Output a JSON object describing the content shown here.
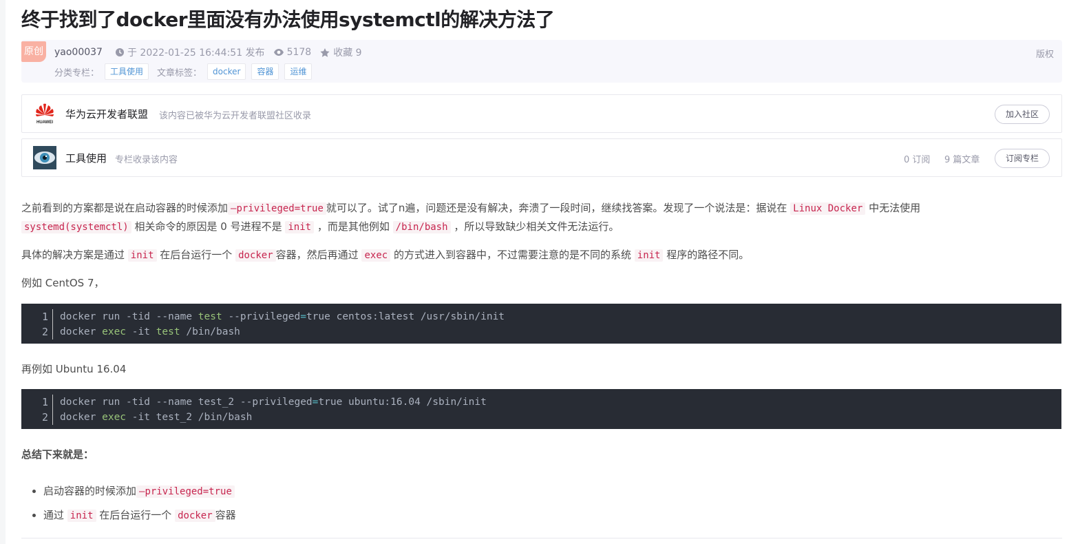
{
  "article": {
    "title": "终于找到了docker里面没有办法使用systemctl的解决方法了",
    "badge": "原创",
    "author": "yao00037",
    "published": "于 2022-01-25 16:44:51 发布",
    "views": "5178",
    "collect": "收藏 9",
    "copyright": "版权",
    "category_label": "分类专栏：",
    "category": "工具使用",
    "tags_label": "文章标签：",
    "tags": [
      "docker",
      "容器",
      "运维"
    ]
  },
  "huawei_card": {
    "name": "华为云开发者联盟",
    "desc": "该内容已被华为云开发者联盟社区收录",
    "button": "加入社区",
    "logo_text": "HUAWEI"
  },
  "column_card": {
    "name": "工具使用",
    "desc": "专栏收录该内容",
    "subs": "0 订阅",
    "count": "9 篇文章",
    "button": "订阅专栏"
  },
  "content": {
    "p1_a": "之前看到的方案都是说在启动容器的时候添加",
    "p1_code1": "–privileged=true",
    "p1_b": "就可以了。试了n遍，问题还是没有解决，奔溃了一段时间，继续找答案。发现了一个说法是：据说在",
    "p1_code2": "Linux Docker",
    "p1_c": "中无法使用",
    "p1_code3": "systemd(systemctl)",
    "p1_d": "相关命令的原因是 0 号进程不是",
    "p1_code4": "init",
    "p1_e": "，而是其他例如",
    "p1_code5": "/bin/bash",
    "p1_f": "，所以导致缺少相关文件无法运行。",
    "p2_a": "具体的解决方案是通过",
    "p2_code1": "init",
    "p2_b": "在后台运行一个",
    "p2_code2": "docker",
    "p2_c": "容器，然后再通过",
    "p2_code3": "exec",
    "p2_d": "的方式进入到容器中，不过需要注意的是不同的系统",
    "p2_code4": "init",
    "p2_e": "程序的路径不同。",
    "p3": "例如 CentOS 7，",
    "code1_line1": [
      "docker run -tid --name ",
      "test",
      " --privileged",
      "=",
      "true centos:latest /usr/sbin/init"
    ],
    "code1_line2": [
      "docker ",
      "exec",
      " -it ",
      "test",
      " /bin/bash"
    ],
    "p4": "再例如 Ubuntu 16.04",
    "code2_line1": [
      "docker run -tid --name test_2 --privileged",
      "=",
      "true ubuntu:16.04 /sbin/init"
    ],
    "code2_line2": [
      "docker ",
      "exec",
      " -it test_2 /bin/bash"
    ],
    "summary": "总结下来就是：",
    "li1_a": "启动容器的时候添加",
    "li1_code": "–privileged=true",
    "li2_a": "通过",
    "li2_code1": "init",
    "li2_b": "在后台运行一个",
    "li2_code2": "docker",
    "li2_c": "容器"
  },
  "line_numbers": [
    "1",
    "2"
  ]
}
